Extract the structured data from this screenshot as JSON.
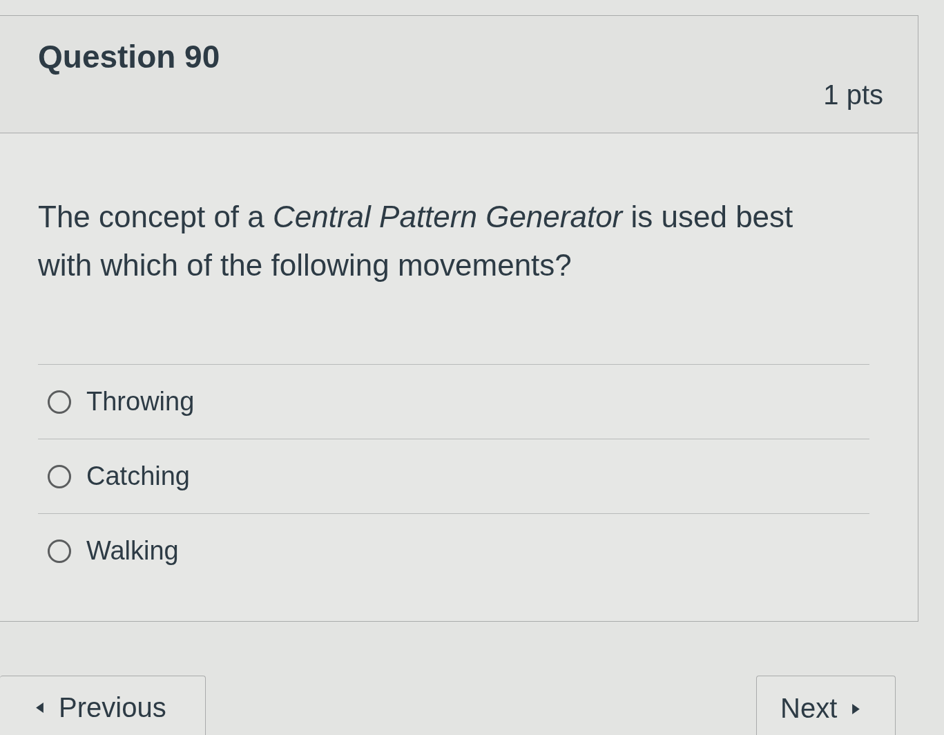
{
  "question": {
    "title": "Question 90",
    "points": "1 pts",
    "text": "The concept of a *Central Pattern Generator* is used best with which of the following movements?"
  },
  "answers": [
    {
      "label": "Throwing",
      "selected": false
    },
    {
      "label": "Catching",
      "selected": false
    },
    {
      "label": "Walking",
      "selected": false
    }
  ],
  "navigation": {
    "previous": "Previous",
    "next": "Next"
  }
}
